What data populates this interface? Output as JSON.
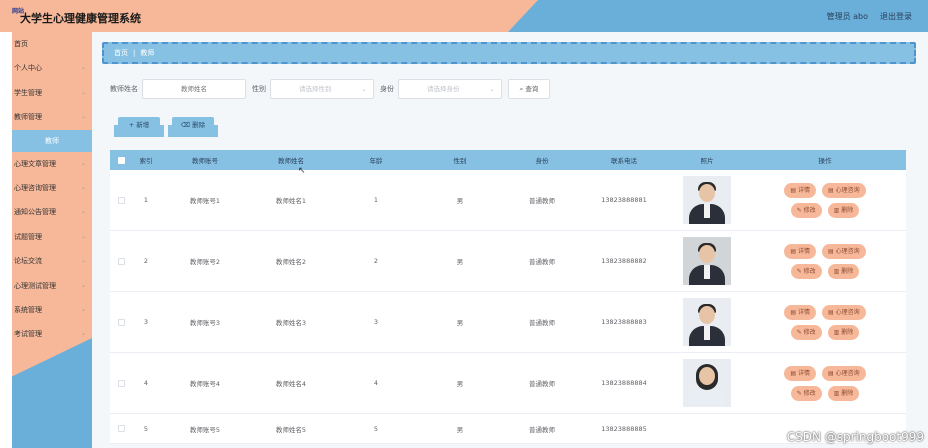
{
  "header": {
    "logo_text": "网站",
    "title": "大学生心理健康管理系统",
    "user_label": "管理员 abo",
    "logout_label": "退出登录"
  },
  "sidebar": {
    "items": [
      {
        "label": "首页",
        "has_arrow": false
      },
      {
        "label": "个人中心",
        "has_arrow": true
      },
      {
        "label": "学生管理",
        "has_arrow": true
      },
      {
        "label": "教师管理",
        "has_arrow": true
      },
      {
        "label": "心理文章管理",
        "has_arrow": true
      },
      {
        "label": "心理咨询管理",
        "has_arrow": true
      },
      {
        "label": "通知公告管理",
        "has_arrow": true
      },
      {
        "label": "试题管理",
        "has_arrow": true
      },
      {
        "label": "论坛交流",
        "has_arrow": true
      },
      {
        "label": "心理测试管理",
        "has_arrow": true
      },
      {
        "label": "系统管理",
        "has_arrow": true
      },
      {
        "label": "考试管理",
        "has_arrow": true
      }
    ],
    "active_sub": "教师"
  },
  "breadcrumb": {
    "home": "首页",
    "current": "教师"
  },
  "filters": {
    "name_label": "教师姓名",
    "name_placeholder": "教师姓名",
    "gender_label": "性别",
    "gender_placeholder": "请选择性别",
    "role_label": "身份",
    "role_placeholder": "请选择身份",
    "search_label": "查询"
  },
  "toolbar": {
    "add_label": "新增",
    "delete_label": "删除"
  },
  "table": {
    "headers": [
      "索引",
      "教师账号",
      "教师姓名",
      "年龄",
      "性别",
      "身份",
      "联系电话",
      "照片",
      "操作"
    ],
    "rows": [
      {
        "index": "1",
        "account": "教师账号1",
        "name": "教师姓名1",
        "age": "1",
        "gender": "男",
        "role": "普通教师",
        "phone": "13823888881",
        "photo": "male-portrait"
      },
      {
        "index": "2",
        "account": "教师账号2",
        "name": "教师姓名2",
        "age": "2",
        "gender": "男",
        "role": "普通教师",
        "phone": "13823888882",
        "photo": "male-portrait-dark"
      },
      {
        "index": "3",
        "account": "教师账号3",
        "name": "教师姓名3",
        "age": "3",
        "gender": "男",
        "role": "普通教师",
        "phone": "13823888883",
        "photo": "male-portrait"
      },
      {
        "index": "4",
        "account": "教师账号4",
        "name": "教师姓名4",
        "age": "4",
        "gender": "男",
        "role": "普通教师",
        "phone": "13823888884",
        "photo": "female-portrait"
      },
      {
        "index": "5",
        "account": "教师账号5",
        "name": "教师姓名5",
        "age": "5",
        "gender": "男",
        "role": "普通教师",
        "phone": "13823888885",
        "photo": ""
      }
    ],
    "row_actions": {
      "detail": "详情",
      "consult": "心理咨询",
      "edit": "修改",
      "delete": "删除"
    }
  },
  "watermark": "CSDN @springboot999",
  "colors": {
    "peach": "#f7b89a",
    "blue": "#6aafda",
    "light_blue": "#86c1e3"
  }
}
